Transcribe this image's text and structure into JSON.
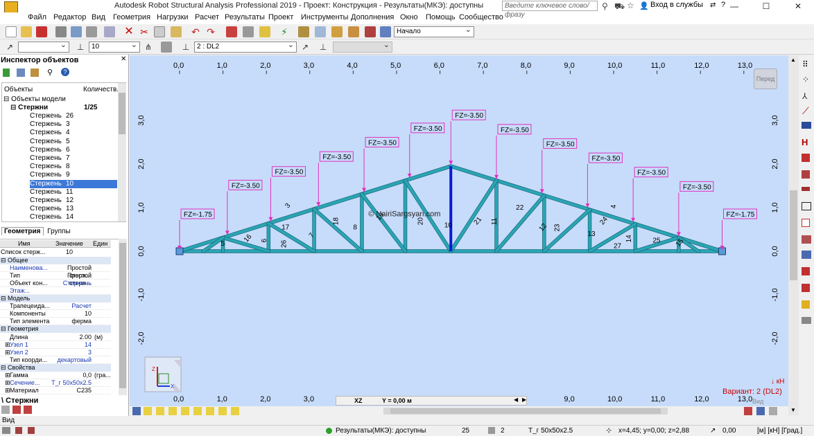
{
  "window": {
    "title": "Autodesk Robot Structural Analysis Professional 2019 - Проект: Конструкция - Результаты(МКЭ): доступны",
    "logo_text": "PRO"
  },
  "menu": [
    "Файл",
    "Редактор",
    "Вид",
    "Геометрия",
    "Нагрузки",
    "Расчет",
    "Результаты",
    "Проект",
    "Инструменты",
    "Дополнения",
    "Окно",
    "Помощь",
    "Сообщество"
  ],
  "search": {
    "placeholder": "Введите ключевое слово/фразу"
  },
  "login": "Вход в службы",
  "toolbar": {
    "view_combo": "Начало",
    "number_field": "10",
    "load_case_combo": "2 : DL2"
  },
  "inspector": {
    "title": "Инспектор объектов",
    "col_objects": "Объекты",
    "col_count": "Количеств...",
    "model_objects": "Объекты модели",
    "bars_label": "Стержни",
    "bars_count": "1/25",
    "bar_items": [
      {
        "label": "Стержень",
        "num": "26"
      },
      {
        "label": "Стержень",
        "num": "3"
      },
      {
        "label": "Стержень",
        "num": "4"
      },
      {
        "label": "Стержень",
        "num": "5"
      },
      {
        "label": "Стержень",
        "num": "6"
      },
      {
        "label": "Стержень",
        "num": "7"
      },
      {
        "label": "Стержень",
        "num": "8"
      },
      {
        "label": "Стержень",
        "num": "9"
      },
      {
        "label": "Стержень",
        "num": "10"
      },
      {
        "label": "Стержень",
        "num": "11"
      },
      {
        "label": "Стержень",
        "num": "12"
      },
      {
        "label": "Стержень",
        "num": "13"
      },
      {
        "label": "Стержень",
        "num": "14"
      }
    ],
    "tabs": [
      "Геометрия",
      "Группы"
    ],
    "props_header": {
      "name": "Имя",
      "value": "Значение",
      "unit": "Един"
    },
    "list_row": {
      "name": "Список стерж...",
      "value": "10"
    },
    "groups": [
      {
        "title": "Общее",
        "rows": [
          {
            "name": "Наименова...",
            "value": "Простой стерж...",
            "unit": ""
          },
          {
            "name": "Тип",
            "value": "Простой стерж...",
            "unit": ""
          },
          {
            "name": "Объект кон...",
            "value": "Стержень",
            "unit": ""
          },
          {
            "name": "Этаж...",
            "value": "",
            "unit": ""
          }
        ]
      },
      {
        "title": "Модель",
        "rows": [
          {
            "name": "Трапецеида...",
            "value": "Расчет",
            "unit": ""
          },
          {
            "name": "Компоненты",
            "value": "10",
            "unit": ""
          },
          {
            "name": "Тип элемента",
            "value": "ферма",
            "unit": ""
          }
        ]
      },
      {
        "title": "Геометрия",
        "rows": [
          {
            "name": "Длина",
            "value": "2.00",
            "unit": "(м)"
          },
          {
            "name": "Узел 1",
            "value": "14",
            "unit": ""
          },
          {
            "name": "Узел 2",
            "value": "3",
            "unit": ""
          },
          {
            "name": "Тип коорди...",
            "value": "декартовый",
            "unit": ""
          }
        ]
      },
      {
        "title": "Свойства",
        "rows": [
          {
            "name": "Гамма",
            "value": "0,0",
            "unit": "(гра..."
          },
          {
            "name": "Сечение...",
            "value": "T_г 50x50x2.5",
            "unit": ""
          },
          {
            "name": "Материал",
            "value": "C235",
            "unit": ""
          }
        ]
      }
    ],
    "bottom_tab": "Стержни"
  },
  "viewport": {
    "top_ticks": [
      "0,0",
      "1,0",
      "2,0",
      "3,0",
      "4,0",
      "5,0",
      "6,0",
      "7,0",
      "8,0",
      "9,0",
      "10,0",
      "11,0",
      "12,0",
      "13,0"
    ],
    "left_ticks": [
      "3,0",
      "2,0",
      "1,0",
      "0,0",
      "-1,0",
      "-2,0"
    ],
    "right_ticks": [
      "3,0",
      "2,0",
      "1,0",
      "0,0",
      "-1,0",
      "-2,0"
    ],
    "bottom_ticks": [
      "0,0",
      "1,0",
      "2,0",
      "3,0",
      "9,0",
      "10,0",
      "11,0",
      "12,0",
      "13,0"
    ],
    "front_button": "Перед",
    "loads": [
      "FZ=-1.75",
      "FZ=-3.50",
      "FZ=-3.50",
      "FZ=-3.50",
      "FZ=-3.50",
      "FZ=-3.50",
      "FZ=-3.50",
      "FZ=-3.50",
      "FZ=-3.50",
      "FZ=-3.50",
      "FZ=-3.50",
      "FZ=-3.50",
      "FZ=-1.75"
    ],
    "bar_labels": [
      "5",
      "16",
      "6",
      "17",
      "7",
      "18",
      "8",
      "19",
      "20",
      "10",
      "21",
      "11",
      "22",
      "12",
      "23",
      "13",
      "24",
      "14",
      "25",
      "15",
      "26",
      "27",
      "3",
      "4"
    ],
    "watermark": "© NairiSargsyan.com",
    "units": "кН",
    "variant": "Вариант: 2 (DL2)",
    "view_hint": "Вид",
    "plane": "XZ",
    "y_value": "Y = 0,00 м",
    "axis_x": "X",
    "axis_z": "Z"
  },
  "vid_label": "Вид",
  "status": {
    "results": "Результаты(МКЭ): доступны",
    "n1": "25",
    "n2": "2",
    "section": "T_г 50x50x2.5",
    "coords": "x=4,45; y=0,00; z=2,88",
    "value": "0,00",
    "units": "[м] [кН] [Град.]"
  }
}
